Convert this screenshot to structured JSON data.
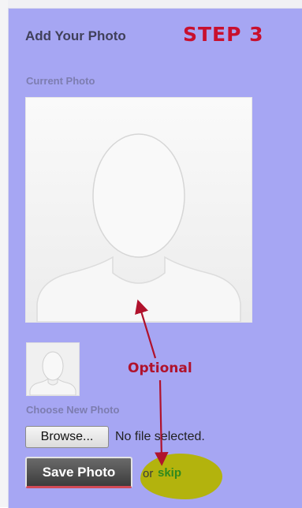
{
  "header": {
    "title": "Add Your Photo",
    "step_label": "STEP 3"
  },
  "current_photo": {
    "label": "Current Photo",
    "icon": "default-avatar-silhouette"
  },
  "new_photo": {
    "label": "Choose New Photo",
    "thumb_icon": "default-avatar-silhouette",
    "browse_label": "Browse...",
    "file_status": "No file selected."
  },
  "actions": {
    "save_label": "Save Photo",
    "or_text": "or",
    "skip_label": "skip"
  },
  "annotation": {
    "optional_label": "Optional",
    "color": "#b0122c",
    "highlight_color": "#b3b300"
  },
  "colors": {
    "panel_bg": "#a6a6f3",
    "step_color": "#c8102e",
    "skip_color": "#2f8a1e"
  }
}
